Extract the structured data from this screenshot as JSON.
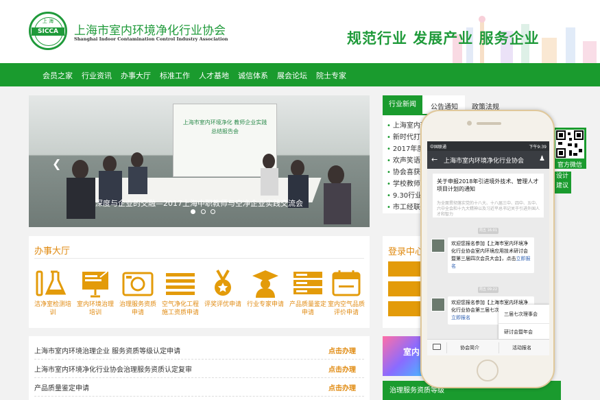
{
  "header": {
    "org_name_cn": "上海市室内环境净化行业协会",
    "org_name_en": "Shanghai Indoor Contamination Control Industry Association",
    "logo_text": "SICCA",
    "logo_top_text": "上  海",
    "slogan": "规范行业 发展产业 服务企业"
  },
  "nav": {
    "items": [
      "会员之家",
      "行业资讯",
      "办事大厅",
      "标准工作",
      "人才基地",
      "诚信体系",
      "展会论坛",
      "院士专家"
    ]
  },
  "banner": {
    "screen_title": "上海市室内环境净化 教师企业实践总结报告会",
    "caption": "深度与企业的交融—2017上海中职教师与空净企业实践交流会",
    "slide_count": 3,
    "active_slide": 1
  },
  "hall": {
    "title": "办事大厅",
    "services": [
      {
        "label": "洁净室检测培训",
        "icon": "flask-icon"
      },
      {
        "label": "室内环境治理培训",
        "icon": "presentation-icon"
      },
      {
        "label": "治理服务资质申请",
        "icon": "camera-icon"
      },
      {
        "label": "空气净化工程施工资质申请",
        "icon": "lines-icon"
      },
      {
        "label": "评奖评优申请",
        "icon": "medal-icon"
      },
      {
        "label": "行业专家申请",
        "icon": "graduate-icon"
      },
      {
        "label": "产品质量鉴定申请",
        "icon": "server-icon"
      },
      {
        "label": "室内空气品质评价申请",
        "icon": "calendar-icon"
      }
    ]
  },
  "applications": {
    "action_label": "点击办理",
    "rows": [
      "上海市室内环境治理企业 服务资质等级认定申请",
      "上海市室内环境净化行业协会治理服务资质认定复审",
      "产品质量鉴定申请"
    ]
  },
  "news": {
    "tabs": [
      "行业新闻",
      "公告通知",
      "政策法规"
    ],
    "items": [
      "上海室内环",
      "新时代打造",
      "2017年度_",
      "欢声笑语庆",
      "协会喜获殊",
      "学校教师进",
      "9.30行业员",
      "市工经联领"
    ]
  },
  "side": {
    "qr_label": "官方微信",
    "suggest_label": "设计建议"
  },
  "login": {
    "title": "登录中心"
  },
  "promo": {
    "text": "室内"
  },
  "bottom_bar": {
    "text": "治理服务资质等级"
  },
  "phone": {
    "status_left": "中国联通",
    "status_right": "下午9:39",
    "account_title": "上海市室内环境净化行业协会",
    "article_title": "关于申报2018年引进境外技术、管理人才项目计划的通知",
    "article_summary": "为全面贯彻落实党的十八大、十八届三中、四中、五中、六中全会和十九大精神以及习近平总书记关于引进外国人才和智力",
    "time1": "周五 16:01",
    "msg1_text": "欢迎您报名参加【上海市室内环境净化行业协会室内环境应用技术研讨会暨第三届四次会员大会】，点击",
    "msg1_link": "立即报名",
    "time2": "周五 09:22",
    "msg2_text": "欢迎您报名参加【上海市室内环境净化行业协会第三届七次理事会】，点击",
    "msg2_link": "立即报名",
    "popup_items": [
      "三届七次理事会",
      "研讨会暨年会"
    ],
    "menu_items": [
      "协会简介",
      "活动报名"
    ]
  }
}
